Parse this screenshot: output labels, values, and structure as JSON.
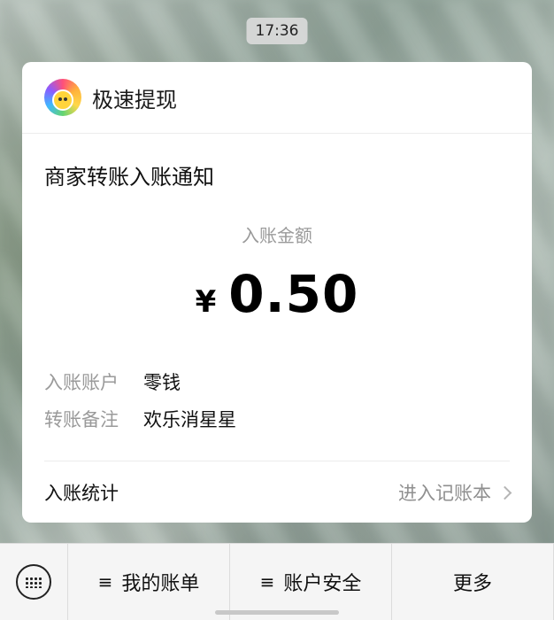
{
  "status": {
    "time": "17:36"
  },
  "card": {
    "app_name": "极速提现",
    "title": "商家转账入账通知",
    "amount_label": "入账金额",
    "currency": "¥",
    "amount": "0.50",
    "details": [
      {
        "label": "入账账户",
        "value": "零钱"
      },
      {
        "label": "转账备注",
        "value": "欢乐消星星"
      }
    ],
    "stats_label": "入账统计",
    "ledger_link": "进入记账本"
  },
  "bottom_menu": {
    "items": [
      {
        "glyph": "≡",
        "label": "我的账单"
      },
      {
        "glyph": "≡",
        "label": "账户安全"
      },
      {
        "glyph": "",
        "label": "更多"
      }
    ]
  }
}
